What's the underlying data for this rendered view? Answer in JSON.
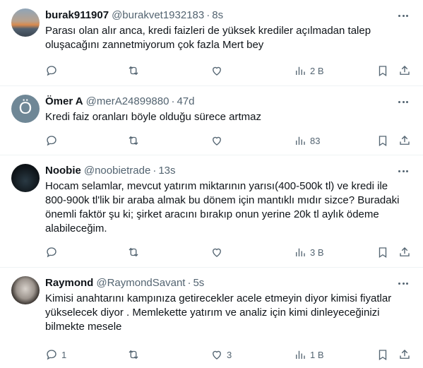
{
  "tweets": [
    {
      "name": "burak911907",
      "handle": "@burakvet1932183",
      "separator": "·",
      "time": "8s",
      "avatar": "sunset-photo",
      "text": "Parası olan alır anca, kredi faizleri de yüksek krediler açılmadan talep oluşacağını zannetmiyorum çok fazla Mert bey",
      "replies": "",
      "retweets": "",
      "likes": "",
      "views": "2 B"
    },
    {
      "name": "Ömer A",
      "handle": "@merA24899880",
      "separator": "·",
      "time": "47d",
      "avatar": "letter",
      "avatar_letter": "Ö",
      "text": "Kredi faiz oranları böyle olduğu sürece artmaz",
      "replies": "",
      "retweets": "",
      "likes": "",
      "views": "83"
    },
    {
      "name": "Noobie",
      "handle": "@noobietrade",
      "separator": "·",
      "time": "13s",
      "avatar": "dark-hooded-figure",
      "text": "Hocam selamlar, mevcut yatırım miktarının yarısı(400-500k tl) ve kredi ile 800-900k tl'lik bir araba almak bu dönem için mantıklı mıdır sizce? Buradaki önemli faktör şu ki; şirket aracını bırakıp onun yerine 20k tl aylık ödeme alabileceğim.",
      "replies": "",
      "retweets": "",
      "likes": "",
      "views": "3 B"
    },
    {
      "name": "Raymond",
      "handle": "@RaymondSavant",
      "separator": "·",
      "time": "5s",
      "avatar": "face-photo",
      "text": "Kimisi anahtarını kampınıza getirecekler acele etmeyin diyor kimisi fiyatlar yükselecek diyor . Memlekette yatırım ve analiz için kimi dinleyeceğinizi bilmekte mesele",
      "replies": "1",
      "retweets": "",
      "likes": "3",
      "views": "1 B"
    }
  ],
  "icons": {
    "reply": "reply-icon",
    "retweet": "retweet-icon",
    "like": "like-icon",
    "views": "views-icon",
    "bookmark": "bookmark-icon",
    "share": "share-icon",
    "more": "more-icon"
  },
  "colors": {
    "text": "#0f1419",
    "secondary": "#536471",
    "border": "#eff3f4"
  }
}
